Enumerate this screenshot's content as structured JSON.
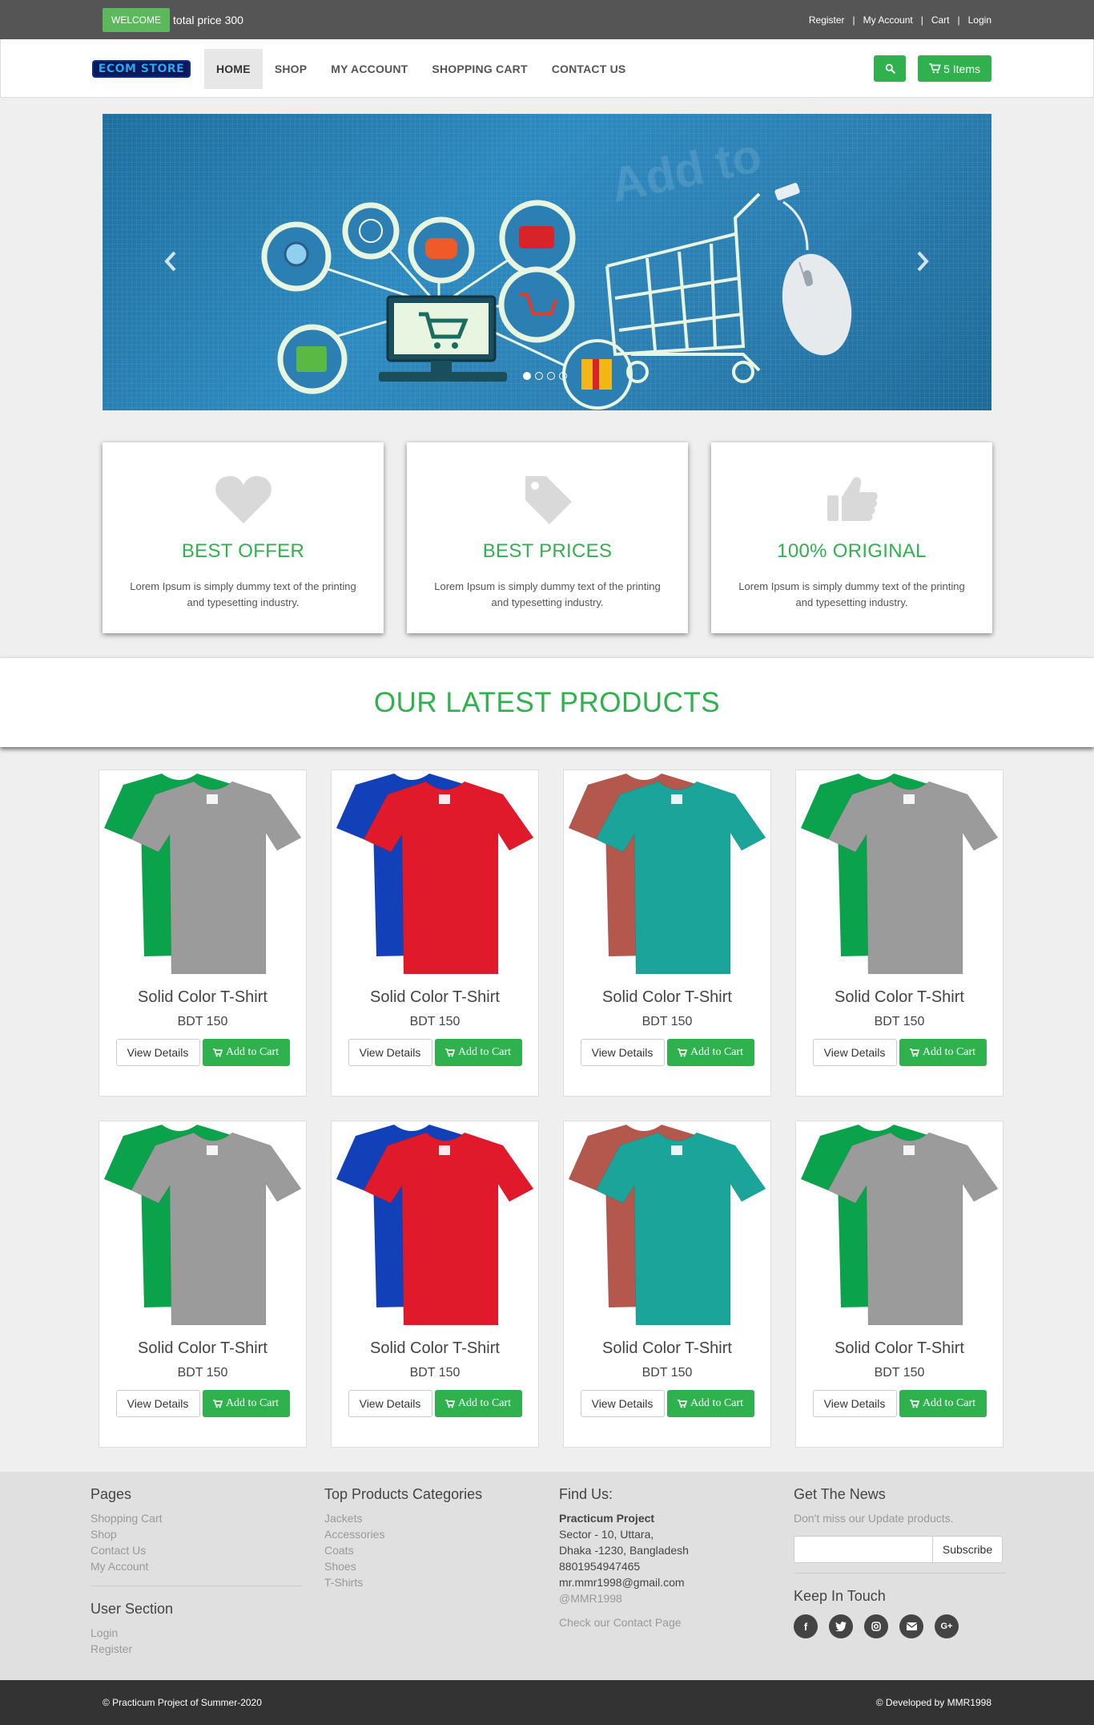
{
  "topbar": {
    "welcome": "WELCOME",
    "total_price": "total price 300",
    "links": [
      "Register",
      "My Account",
      "Cart",
      "Login"
    ]
  },
  "navbar": {
    "logo": "ECOM STORE",
    "items": [
      "HOME",
      "SHOP",
      "MY ACCOUNT",
      "SHOPPING CART",
      "CONTACT US"
    ],
    "active": "HOME",
    "search_icon": "search-icon",
    "cart_label": "5 Items",
    "cart_icon": "shopping-cart-icon"
  },
  "carousel": {
    "slides": 4,
    "active_slide": 1,
    "prev_icon": "chevron-left-icon",
    "next_icon": "chevron-right-icon"
  },
  "features": [
    {
      "icon": "heart-icon",
      "title": "BEST OFFER",
      "text": "Lorem Ipsum is simply dummy text of the printing and typesetting industry."
    },
    {
      "icon": "tag-icon",
      "title": "BEST PRICES",
      "text": "Lorem Ipsum is simply dummy text of the printing and typesetting industry."
    },
    {
      "icon": "thumbs-up-icon",
      "title": "100% ORIGINAL",
      "text": "Lorem Ipsum is simply dummy text of the printing and typesetting industry."
    }
  ],
  "latest": {
    "title": "OUR LATEST PRODUCTS"
  },
  "products": [
    {
      "name": "Solid Color T-Shirt",
      "price": "BDT 150",
      "colors": [
        "#0aa24a",
        "#9b9b9b"
      ]
    },
    {
      "name": "Solid Color T-Shirt",
      "price": "BDT 150",
      "colors": [
        "#1240b8",
        "#e01a2a"
      ]
    },
    {
      "name": "Solid Color T-Shirt",
      "price": "BDT 150",
      "colors": [
        "#b4584d",
        "#1aa49a"
      ]
    },
    {
      "name": "Solid Color T-Shirt",
      "price": "BDT 150",
      "colors": [
        "#0aa24a",
        "#9b9b9b"
      ]
    },
    {
      "name": "Solid Color T-Shirt",
      "price": "BDT 150",
      "colors": [
        "#0aa24a",
        "#9b9b9b"
      ]
    },
    {
      "name": "Solid Color T-Shirt",
      "price": "BDT 150",
      "colors": [
        "#1240b8",
        "#e01a2a"
      ]
    },
    {
      "name": "Solid Color T-Shirt",
      "price": "BDT 150",
      "colors": [
        "#b4584d",
        "#1aa49a"
      ]
    },
    {
      "name": "Solid Color T-Shirt",
      "price": "BDT 150",
      "colors": [
        "#0aa24a",
        "#9b9b9b"
      ]
    }
  ],
  "product_buttons": {
    "view": "View Details",
    "add": "Add to Cart"
  },
  "footer": {
    "pages": {
      "title": "Pages",
      "links": [
        "Shopping Cart",
        "Shop",
        "Contact Us",
        "My Account"
      ]
    },
    "user_section": {
      "title": "User Section",
      "links": [
        "Login",
        "Register"
      ]
    },
    "categories": {
      "title": "Top Products Categories",
      "links": [
        "Jackets",
        "Accessories",
        "Coats",
        "Shoes",
        "T-Shirts"
      ]
    },
    "find_us": {
      "title": "Find Us:",
      "name": "Practicum Project",
      "address1": "Sector - 10, Uttara,",
      "address2": "Dhaka -1230, Bangladesh",
      "phone": "8801954947465",
      "email": "mr.mmr1998@gmail.com",
      "handle": "@MMR1998",
      "contact_link": "Check our Contact Page"
    },
    "news": {
      "title": "Get The News",
      "text": "Don't miss our Update products.",
      "subscribe": "Subscribe"
    },
    "keep_in_touch": {
      "title": "Keep In Touch",
      "icons": [
        "facebook-icon",
        "twitter-icon",
        "instagram-icon",
        "envelope-icon",
        "google-plus-icon"
      ]
    }
  },
  "bottombar": {
    "left": "© Practicum Project of Summer-2020",
    "right": "© Developed by MMR1998"
  },
  "colors": {
    "accent": "#2fb14d",
    "topbar": "#555555",
    "bottombar": "#333333"
  }
}
